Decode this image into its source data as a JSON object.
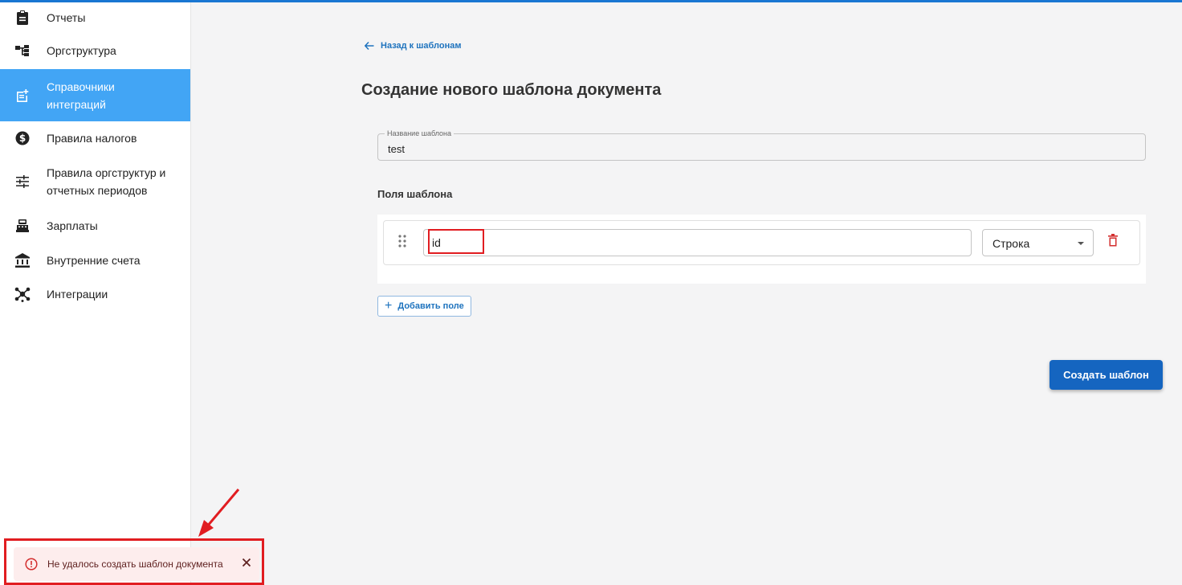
{
  "sidebar": {
    "items": [
      {
        "label": "Отчеты",
        "icon": "clipboard-icon"
      },
      {
        "label": "Оргструктура",
        "icon": "org-tree-icon"
      },
      {
        "label": "Справочники интеграций",
        "icon": "post-add-icon",
        "active": true
      },
      {
        "label": "Правила налогов",
        "icon": "dollar-circle-icon"
      },
      {
        "label": "Правила оргструктур и отчетных периодов",
        "icon": "tune-icon"
      },
      {
        "label": "Зарплаты",
        "icon": "calculator-icon"
      },
      {
        "label": "Внутренние счета",
        "icon": "bank-icon"
      },
      {
        "label": "Интеграции",
        "icon": "hub-icon"
      }
    ]
  },
  "main": {
    "back_link": "Назад к шаблонам",
    "title": "Создание нового шаблона документа",
    "template_name": {
      "label": "Название шаблона",
      "value": "test"
    },
    "fields_title": "Поля шаблона",
    "fields": [
      {
        "name": "id",
        "type": "Строка"
      }
    ],
    "add_field": "Добавить поле",
    "create_button": "Создать шаблон"
  },
  "toast": {
    "message": "Не удалось создать шаблон документа",
    "severity": "error"
  },
  "colors": {
    "accent": "#42a5f5",
    "primary": "#1565c0",
    "error": "#d32f2f",
    "annotation": "#e11d21"
  }
}
